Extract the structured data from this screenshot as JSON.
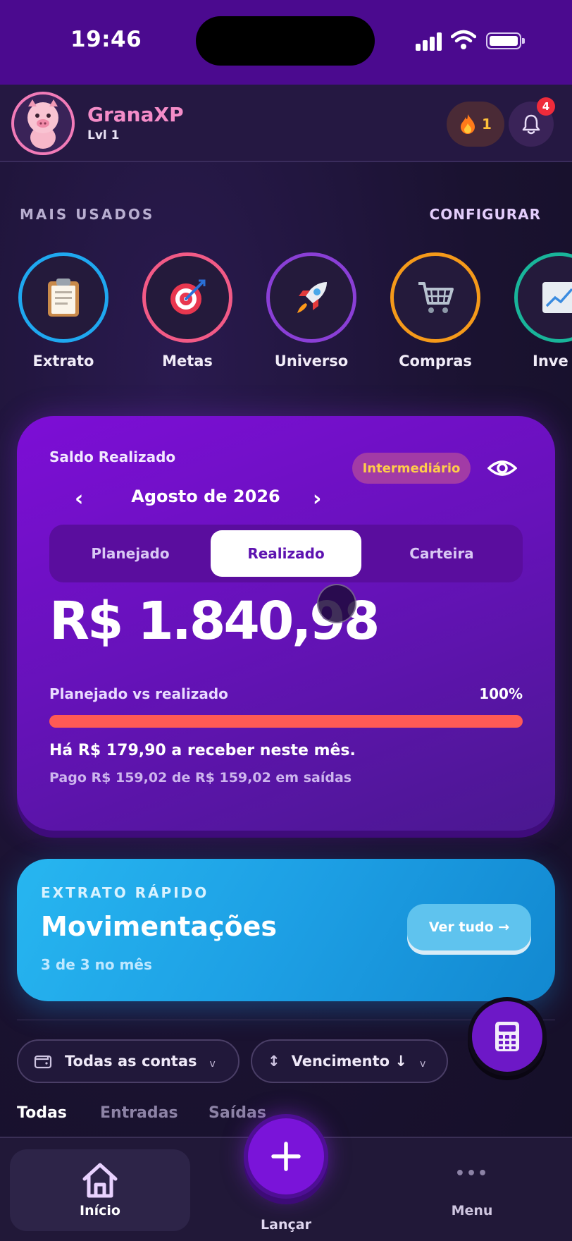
{
  "status_bar": {
    "time": "19:46"
  },
  "header": {
    "app_name": "GranaXP",
    "level": "Lvl 1",
    "streak_count": "1",
    "notification_count": "4"
  },
  "most_used": {
    "title": "MAIS USADOS",
    "configure_label": "CONFIGURAR",
    "items": [
      {
        "label": "Extrato",
        "icon": "clipboard-icon",
        "ring_color": "#1fa8f0"
      },
      {
        "label": "Metas",
        "icon": "target-icon",
        "ring_color": "#f25a86"
      },
      {
        "label": "Universo",
        "icon": "rocket-icon",
        "ring_color": "#8a3fd6"
      },
      {
        "label": "Compras",
        "icon": "cart-icon",
        "ring_color": "#f59a1a"
      },
      {
        "label": "Inve",
        "icon": "chart-icon",
        "ring_color": "#19b59a"
      }
    ]
  },
  "balance_card": {
    "title": "Saldo Realizado",
    "level_badge": "Intermediário",
    "month": "Agosto de 2026",
    "prev_symbol": "‹",
    "next_symbol": "›",
    "segments": [
      "Planejado",
      "Realizado",
      "Carteira"
    ],
    "active_segment": "Realizado",
    "amount": "R$ 1.840,98",
    "planned_vs_realized_label": "Planejado vs realizado",
    "planned_vs_realized_pct": "100%",
    "progress_fraction": 1.0,
    "to_receive_text": "Há R$ 179,90 a receber neste mês.",
    "paid_text": "Pago R$ 159,02 de R$ 159,02 em saídas"
  },
  "quick_statement": {
    "kicker": "EXTRATO RÁPIDO",
    "title": "Movimentações",
    "subtitle": "3 de 3 no mês",
    "see_all_label": "Ver tudo →"
  },
  "filters": {
    "accounts": "Todas as contas",
    "sort": "Vencimento ↓",
    "sort_icon": "↕",
    "chevron": "v"
  },
  "tabs": [
    "Todas",
    "Entradas",
    "Saídas"
  ],
  "bottom_nav": {
    "home": "Início",
    "launch": "Lançar",
    "menu": "Menu",
    "menu_dots": "•••"
  },
  "colors": {
    "accent": "#7a14d9",
    "brand_pink": "#f48cc8",
    "progress": "#ff5a55",
    "quick_blue": "#1d9fe4"
  }
}
